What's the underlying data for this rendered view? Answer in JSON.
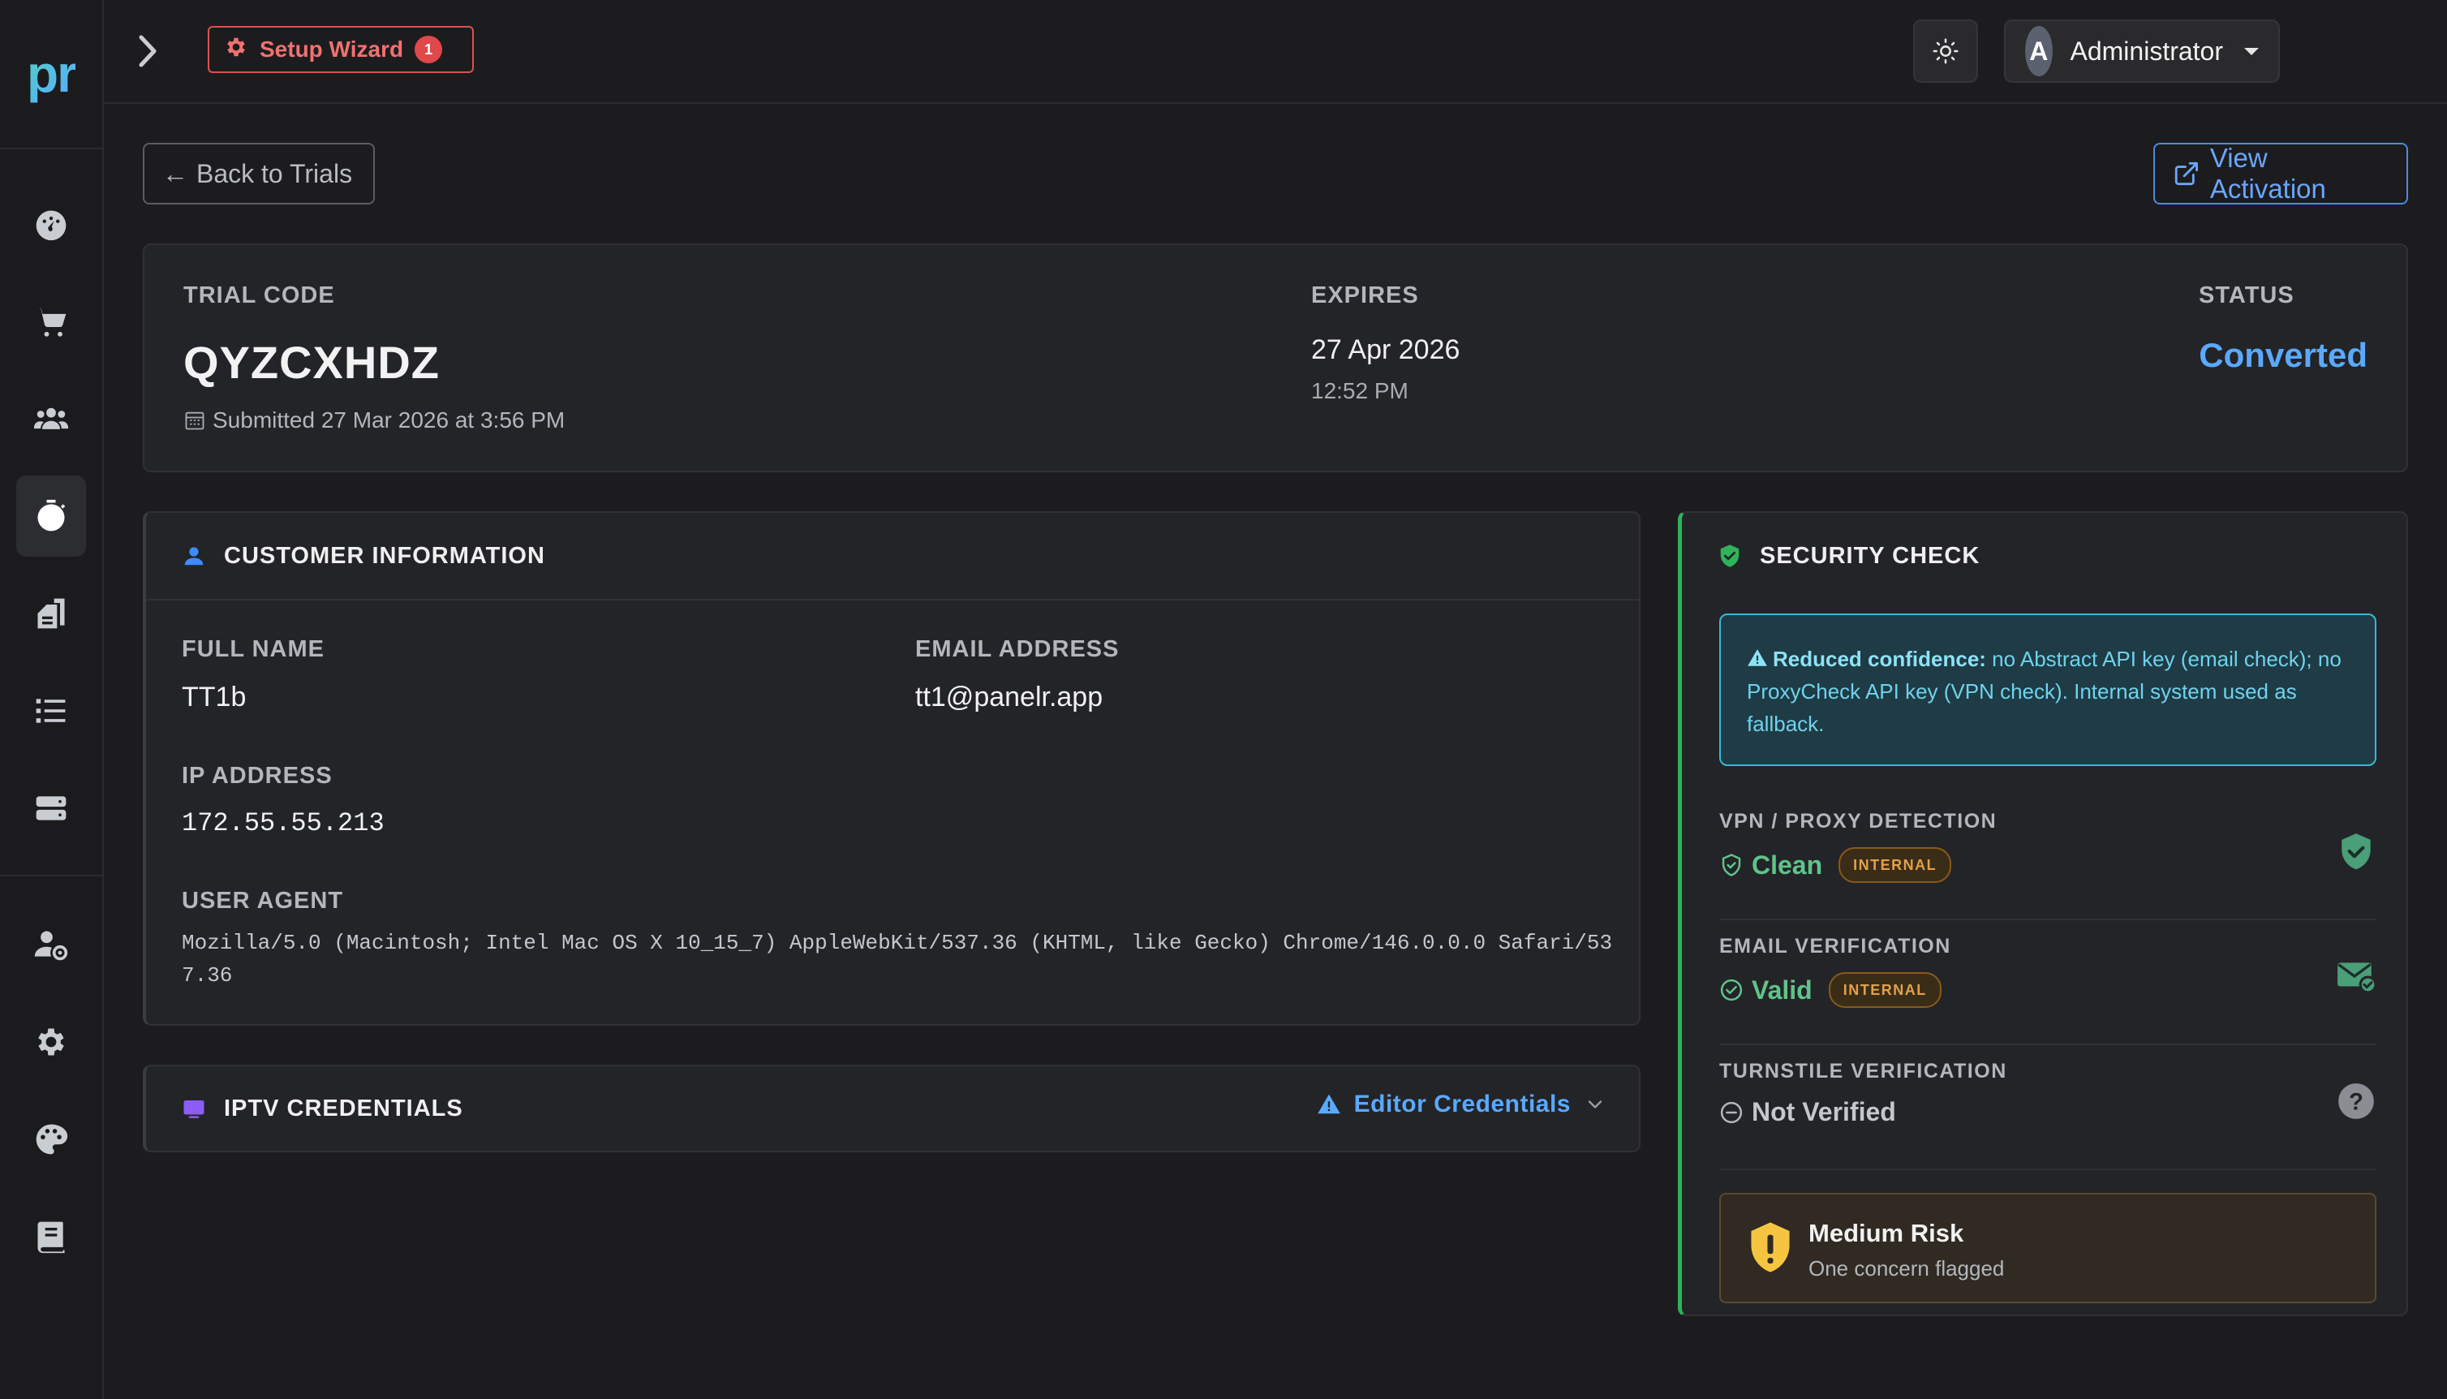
{
  "brand": {
    "logo_text": "pr"
  },
  "topbar": {
    "wizard_label": "Setup Wizard",
    "wizard_badge": "1",
    "user_initial": "A",
    "user_name": "Administrator"
  },
  "sidebar": {
    "items": [
      {
        "icon": "dashboard-icon"
      },
      {
        "icon": "cart-icon"
      },
      {
        "icon": "users-icon"
      },
      {
        "icon": "stopwatch-icon",
        "active": true
      },
      {
        "icon": "documents-icon"
      },
      {
        "icon": "list-icon"
      },
      {
        "icon": "server-icon"
      },
      {
        "icon": "user-settings-icon"
      },
      {
        "icon": "gear-icon"
      },
      {
        "icon": "palette-icon"
      },
      {
        "icon": "book-icon"
      }
    ]
  },
  "actions": {
    "back_label": "Back to Trials",
    "view_activation_label": "View Activation"
  },
  "trial": {
    "code_label": "TRIAL CODE",
    "code": "QYZCXHDZ",
    "submitted": "Submitted 27 Mar 2026 at 3:56 PM",
    "expires_label": "EXPIRES",
    "expires_date": "27 Apr 2026",
    "expires_time": "12:52 PM",
    "status_label": "STATUS",
    "status": "Converted"
  },
  "customer": {
    "title": "CUSTOMER INFORMATION",
    "full_name_label": "FULL NAME",
    "full_name": "TT1b",
    "email_label": "EMAIL ADDRESS",
    "email": "tt1@panelr.app",
    "ip_label": "IP ADDRESS",
    "ip": "172.55.55.213",
    "ua_label": "USER AGENT",
    "ua": "Mozilla/5.0 (Macintosh; Intel Mac OS X 10_15_7) AppleWebKit/537.36 (KHTML, like Gecko) Chrome/146.0.0.0 Safari/537.36"
  },
  "iptv": {
    "title": "IPTV CREDENTIALS",
    "editor_label": "Editor Credentials"
  },
  "security": {
    "title": "SECURITY CHECK",
    "alert_bold": "Reduced confidence:",
    "alert_text": " no Abstract API key (email check); no ProxyCheck API key (VPN check). Internal system used as fallback.",
    "vpn_label": "VPN / PROXY DETECTION",
    "vpn_value": "Clean",
    "vpn_pill": "INTERNAL",
    "email_label": "EMAIL VERIFICATION",
    "email_value": "Valid",
    "email_pill": "INTERNAL",
    "turnstile_label": "TURNSTILE VERIFICATION",
    "turnstile_value": "Not Verified",
    "risk_title": "Medium Risk",
    "risk_sub": "One concern flagged",
    "colors": {
      "ok": "#5fc48a",
      "warn": "#e2a04a",
      "info": "#6fd3ec",
      "risk": "#f5c542"
    }
  }
}
